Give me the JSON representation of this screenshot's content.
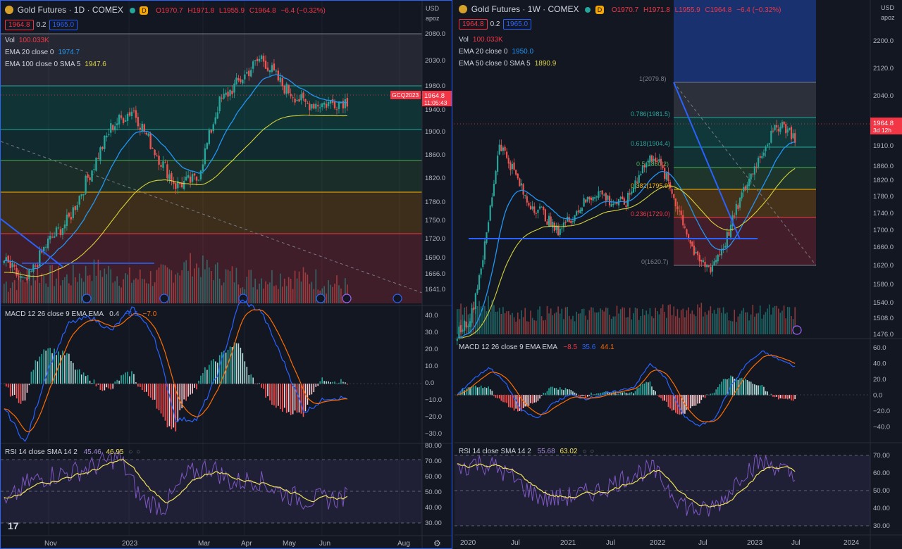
{
  "left": {
    "symbol_title": "Gold Futures · 1D · COMEX",
    "ohlc": {
      "o": "O1970.7",
      "h": "H1971.8",
      "l": "L1955.9",
      "c": "C1964.8",
      "chg": "−6.4 (−0.32%)"
    },
    "sell_price": "1964.8",
    "spread": "0.2",
    "buy_price": "1965.0",
    "currency": "USD",
    "scale_unit": "apoz",
    "vol_label": "Vol",
    "vol_value": "100.033K",
    "ema1_label": "EMA 20 close 0",
    "ema1_value": "1974.7",
    "ema2_label": "EMA 100 close 0 SMA 5",
    "ema2_value": "1947.6",
    "price_ticks": [
      "2080.0",
      "2030.0",
      "1980.0",
      "1940.0",
      "1900.0",
      "1860.0",
      "1820.0",
      "1780.0",
      "1750.0",
      "1720.0",
      "1690.0",
      "1666.0",
      "1641.0"
    ],
    "last_price_tag": "1964.8",
    "countdown": "11:05:43",
    "contract_tag": "GCQ2023",
    "macd_label": "MACD 12 26 close 9 EMA EMA",
    "macd_values": [
      "0.4",
      "−6.6",
      "−7.0"
    ],
    "macd_ticks": [
      "40.0",
      "30.0",
      "20.0",
      "10.0",
      "0.0",
      "−10.0",
      "−20.0",
      "−30.0"
    ],
    "rsi_label": "RSI 14 close SMA 14 2",
    "rsi_values": [
      "45.46",
      "46.95"
    ],
    "rsi_ticks": [
      "80.00",
      "70.00",
      "60.00",
      "50.00",
      "40.00",
      "30.00"
    ],
    "time_ticks": [
      "Nov",
      "2023",
      "Mar",
      "Apr",
      "May",
      "Jun",
      "Aug"
    ]
  },
  "right": {
    "symbol_title": "Gold Futures · 1W · COMEX",
    "ohlc": {
      "o": "O1970.7",
      "h": "H1971.8",
      "l": "L1955.9",
      "c": "C1964.8",
      "chg": "−6.4 (−0.32%)"
    },
    "sell_price": "1964.8",
    "spread": "0.2",
    "buy_price": "1965.0",
    "currency": "USD",
    "scale_unit": "apoz",
    "vol_label": "Vol",
    "vol_value": "100.033K",
    "ema1_label": "EMA 20 close 0",
    "ema1_value": "1950.0",
    "ema2_label": "EMA 50 close 0 SMA 5",
    "ema2_value": "1890.9",
    "price_ticks": [
      "2200.0",
      "2120.0",
      "2040.0",
      "1910.0",
      "1860.0",
      "1820.0",
      "1780.0",
      "1740.0",
      "1700.0",
      "1660.0",
      "1620.0",
      "1580.0",
      "1540.0",
      "1508.0",
      "1476.0"
    ],
    "last_price_tag": "1964.8",
    "countdown": "3d 12h",
    "fib_labels": [
      "1(2079.8)",
      "0.786(1981.5)",
      "0.618(1904.4)",
      "0.5(1850.2)",
      "0.382(1795.9)",
      "0.236(1729.0)",
      "0(1620.7)"
    ],
    "macd_label": "MACD 12 26 close 9 EMA EMA",
    "macd_values": [
      "−8.5",
      "35.6",
      "44.1"
    ],
    "macd_ticks": [
      "60.0",
      "40.0",
      "20.0",
      "0.0",
      "−20.0",
      "−40.0"
    ],
    "rsi_label": "RSI 14 close SMA 14 2",
    "rsi_values": [
      "55.68",
      "63.02"
    ],
    "rsi_ticks": [
      "70.00",
      "60.00",
      "50.00",
      "40.00",
      "30.00"
    ],
    "time_ticks": [
      "2020",
      "Jul",
      "2021",
      "Jul",
      "2022",
      "Jul",
      "2023",
      "Jul",
      "2024"
    ]
  },
  "colors": {
    "background": "#131722",
    "up": "#26a69a",
    "down": "#ef5350",
    "ema_fast": "#2196f3",
    "ema_slow": "#d4d23a",
    "macd_line": "#2962ff",
    "signal_line": "#ff6d00",
    "rsi_line": "#7e57c2",
    "rsi_sma": "#f2e25c",
    "accent": "#2962ff"
  }
}
